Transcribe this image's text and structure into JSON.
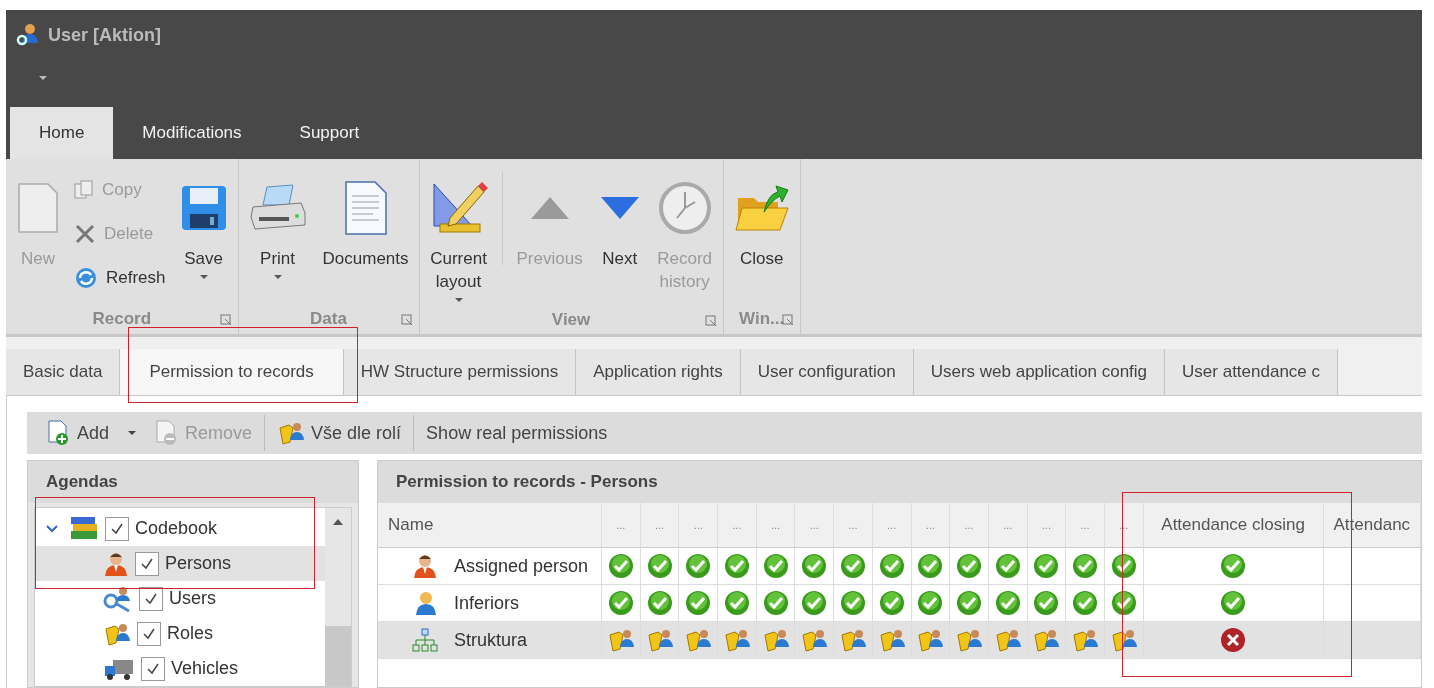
{
  "window": {
    "title": "User [Aktion]"
  },
  "ribbon_tabs": [
    {
      "label": "Home",
      "selected": true
    },
    {
      "label": "Modifications",
      "selected": false
    },
    {
      "label": "Support",
      "selected": false
    }
  ],
  "ribbon_groups": [
    {
      "label": "Record",
      "launcher": true,
      "buttons": [
        {
          "kind": "large",
          "label": "New",
          "disabled": true,
          "dropdown": false
        },
        {
          "kind": "small",
          "label": "Copy",
          "disabled": true
        },
        {
          "kind": "small",
          "label": "Delete",
          "disabled": true
        },
        {
          "kind": "small",
          "label": "Refresh",
          "disabled": false
        },
        {
          "kind": "large",
          "label": "Save",
          "disabled": false,
          "dropdown": true
        }
      ]
    },
    {
      "label": "Data",
      "launcher": true,
      "buttons": [
        {
          "kind": "large",
          "label": "Print",
          "disabled": false,
          "dropdown": true
        },
        {
          "kind": "large",
          "label": "Documents",
          "disabled": false,
          "dropdown": false
        }
      ]
    },
    {
      "label": "View",
      "launcher": true,
      "buttons": [
        {
          "kind": "large",
          "label": "Current layout",
          "disabled": false,
          "dropdown": true
        },
        {
          "kind": "separator"
        },
        {
          "kind": "large",
          "label": "Previous",
          "disabled": true,
          "dropdown": false
        },
        {
          "kind": "large",
          "label": "Next",
          "disabled": false,
          "dropdown": false
        },
        {
          "kind": "large",
          "label": "Record history",
          "disabled": true,
          "dropdown": false
        }
      ]
    },
    {
      "label": "Win...",
      "launcher": true,
      "buttons": [
        {
          "kind": "large",
          "label": "Close",
          "disabled": false,
          "dropdown": false
        }
      ]
    }
  ],
  "doc_tabs": [
    {
      "label": "Basic data",
      "selected": false
    },
    {
      "label": "Permission to records",
      "selected": true
    },
    {
      "label": "HW Structure permissions",
      "selected": false
    },
    {
      "label": "Application rights",
      "selected": false
    },
    {
      "label": "User configuration",
      "selected": false
    },
    {
      "label": "Users web application config",
      "selected": false
    },
    {
      "label": "User attendance c",
      "selected": false
    }
  ],
  "toolbar": [
    {
      "kind": "button",
      "label": "Add",
      "disabled": false
    },
    {
      "kind": "dropdown"
    },
    {
      "kind": "button",
      "label": "Remove",
      "disabled": true
    },
    {
      "kind": "separator"
    },
    {
      "kind": "button",
      "label": "Vše dle rolí",
      "disabled": false
    },
    {
      "kind": "separator"
    },
    {
      "kind": "button",
      "label": "Show real permissions",
      "disabled": false
    }
  ],
  "agendas": {
    "title": "Agendas",
    "tree": [
      {
        "label": "Codebook",
        "checked": true,
        "selected": false,
        "expanded": true,
        "children": [
          {
            "label": "Persons",
            "checked": true,
            "selected": true
          },
          {
            "label": "Users",
            "checked": true,
            "selected": false
          },
          {
            "label": "Roles",
            "checked": true,
            "selected": false
          },
          {
            "label": "Vehicles",
            "checked": true,
            "selected": false
          }
        ]
      }
    ]
  },
  "permissions": {
    "title": "Permission to records - Persons",
    "columns": [
      "Name",
      "...",
      "...",
      "...",
      "...",
      "...",
      "...",
      "...",
      "...",
      "...",
      "...",
      "...",
      "...",
      "...",
      "...",
      "Attendance closing",
      "Attendanc"
    ],
    "rows": [
      {
        "name": "Assigned person",
        "selected": false,
        "cells": [
          {
            "kind": "allowed"
          },
          {
            "kind": "allowed"
          },
          {
            "kind": "allowed"
          },
          {
            "kind": "allowed"
          },
          {
            "kind": "allowed"
          },
          {
            "kind": "allowed"
          },
          {
            "kind": "allowed"
          },
          {
            "kind": "allowed"
          },
          {
            "kind": "allowed"
          },
          {
            "kind": "allowed"
          },
          {
            "kind": "allowed"
          },
          {
            "kind": "allowed"
          },
          {
            "kind": "allowed"
          },
          {
            "kind": "allowed"
          },
          {
            "kind": "allowed"
          },
          {
            "kind": "empty"
          }
        ]
      },
      {
        "name": "Inferiors",
        "selected": false,
        "cells": [
          {
            "kind": "allowed"
          },
          {
            "kind": "allowed"
          },
          {
            "kind": "allowed"
          },
          {
            "kind": "allowed"
          },
          {
            "kind": "allowed"
          },
          {
            "kind": "allowed"
          },
          {
            "kind": "allowed"
          },
          {
            "kind": "allowed"
          },
          {
            "kind": "allowed"
          },
          {
            "kind": "allowed"
          },
          {
            "kind": "allowed"
          },
          {
            "kind": "allowed"
          },
          {
            "kind": "allowed"
          },
          {
            "kind": "allowed"
          },
          {
            "kind": "allowed"
          },
          {
            "kind": "empty"
          }
        ]
      },
      {
        "name": "Struktura",
        "selected": true,
        "cells": [
          {
            "kind": "by-role"
          },
          {
            "kind": "by-role"
          },
          {
            "kind": "by-role"
          },
          {
            "kind": "by-role"
          },
          {
            "kind": "by-role"
          },
          {
            "kind": "by-role"
          },
          {
            "kind": "by-role"
          },
          {
            "kind": "by-role"
          },
          {
            "kind": "by-role"
          },
          {
            "kind": "by-role"
          },
          {
            "kind": "by-role"
          },
          {
            "kind": "by-role"
          },
          {
            "kind": "by-role"
          },
          {
            "kind": "by-role"
          },
          {
            "kind": "denied"
          },
          {
            "kind": "empty"
          }
        ]
      }
    ]
  }
}
